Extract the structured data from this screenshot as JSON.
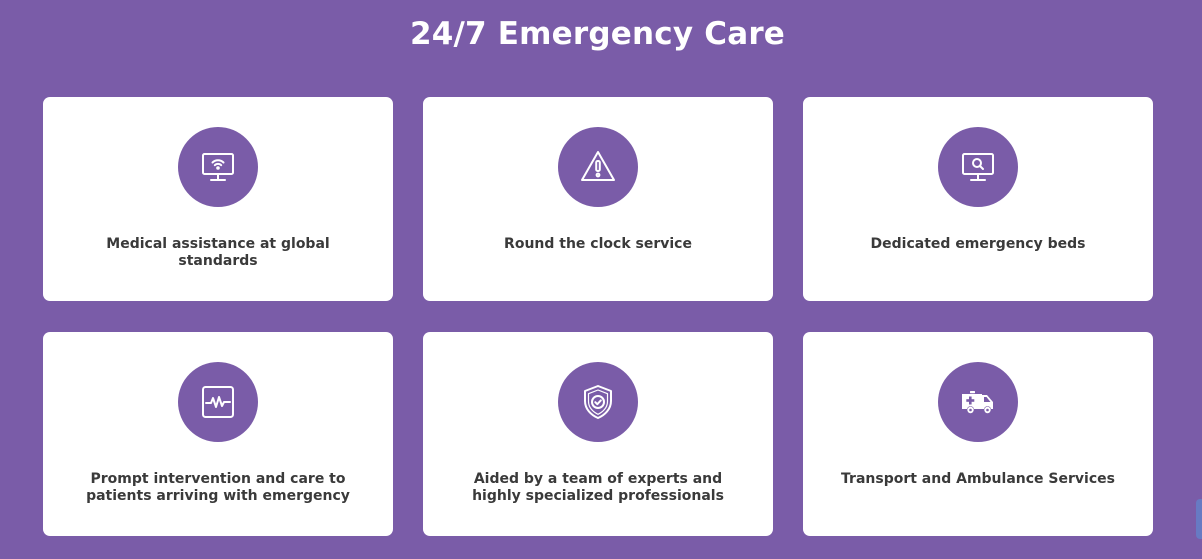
{
  "page": {
    "title": "24/7 Emergency Care",
    "colors": {
      "background": "#7a5ca8",
      "card": "#ffffff",
      "icon_circle": "#7a5ca8",
      "text": "#3a3a3a"
    }
  },
  "cards": [
    {
      "label": "Medical assistance at global standards",
      "icon": "monitor-wifi-icon"
    },
    {
      "label": "Round the clock service",
      "icon": "warning-triangle-icon"
    },
    {
      "label": "Dedicated emergency beds",
      "icon": "monitor-search-icon"
    },
    {
      "label": "Prompt intervention and care to patients arriving with emergency",
      "icon": "heart-monitor-icon"
    },
    {
      "label": "Aided by a team of experts and highly specialized professionals",
      "icon": "shield-check-icon"
    },
    {
      "label": "Transport and Ambulance Services",
      "icon": "ambulance-icon"
    }
  ]
}
